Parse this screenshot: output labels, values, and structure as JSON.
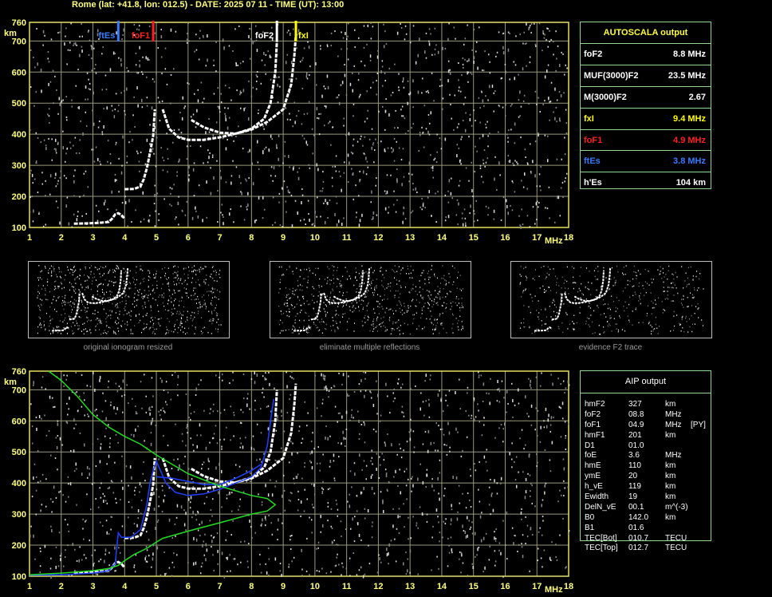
{
  "header": "Rome (lat: +41.8, lon: 012.5) - DATE: 2025 07 11 - TIME (UT): 13:00",
  "colors": {
    "grid": "#9a9a7a",
    "frame": "#e6e060",
    "trace": "#ffffff",
    "fte": "#3a7aff",
    "fof1": "#ff2020",
    "fxi": "#ffff00",
    "green": "#22dd22",
    "blue": "#2040ff",
    "panel_border": "#8fd88f"
  },
  "autoscala": {
    "title": "AUTOSCALA output",
    "rows": [
      {
        "label": "foF2",
        "value": "8.8 MHz",
        "color": "#ffffff"
      },
      {
        "label": "MUF(3000)F2",
        "value": "23.5 MHz",
        "color": "#ffffff"
      },
      {
        "label": "M(3000)F2",
        "value": "2.67",
        "color": "#ffffff"
      },
      {
        "label": "fxI",
        "value": "9.4 MHz",
        "color": "#ffff00"
      },
      {
        "label": "foF1",
        "value": "4.9 MHz",
        "color": "#ff2020"
      },
      {
        "label": "ftEs",
        "value": "3.8 MHz",
        "color": "#3a7aff"
      },
      {
        "label": "h'Es",
        "value": "104    km",
        "color": "#ffffff"
      }
    ]
  },
  "aip": {
    "title": "AIP output",
    "rows": [
      {
        "label": "hmF2",
        "value": "327",
        "unit": "km",
        "note": ""
      },
      {
        "label": "foF2",
        "value": "08.8",
        "unit": "MHz",
        "note": ""
      },
      {
        "label": "foF1",
        "value": "04.9",
        "unit": "MHz",
        "note": "[PY]"
      },
      {
        "label": "hmF1",
        "value": "201",
        "unit": "km",
        "note": ""
      },
      {
        "label": "D1",
        "value": "01.0",
        "unit": "",
        "note": ""
      },
      {
        "label": "foE",
        "value": "3.6",
        "unit": "MHz",
        "note": ""
      },
      {
        "label": "hmE",
        "value": "110",
        "unit": "km",
        "note": ""
      },
      {
        "label": "ymE",
        "value": "20",
        "unit": "km",
        "note": ""
      },
      {
        "label": "h_vE",
        "value": "119",
        "unit": "km",
        "note": ""
      },
      {
        "label": "Ewidth",
        "value": "19",
        "unit": "km",
        "note": ""
      },
      {
        "label": "DelN_vE",
        "value": "00.1",
        "unit": "m^(-3)",
        "note": ""
      },
      {
        "label": "B0",
        "value": "142.0",
        "unit": "km",
        "note": ""
      },
      {
        "label": "B1",
        "value": "01.6",
        "unit": "",
        "note": ""
      },
      {
        "label": "TEC[Bot]",
        "value": "010.7",
        "unit": "TECU",
        "note": ""
      },
      {
        "label": "TEC[Top]",
        "value": "012.7",
        "unit": "TECU",
        "note": ""
      }
    ]
  },
  "thumbnails": [
    {
      "caption": "original ionogram resized"
    },
    {
      "caption": "eliminate multiple reflections"
    },
    {
      "caption": "evidence F2 trace"
    }
  ],
  "chart_data": [
    {
      "type": "scatter",
      "title": "",
      "xlabel": "MHz",
      "ylabel": "km",
      "xlim": [
        1,
        18
      ],
      "ylim": [
        100,
        760
      ],
      "x_ticks": [
        "1",
        "2",
        "3",
        "4",
        "5",
        "6",
        "7",
        "8",
        "9",
        "10",
        "11",
        "12",
        "13",
        "14",
        "15",
        "16",
        "17",
        "18"
      ],
      "y_ticks": [
        "100",
        "200",
        "300",
        "400",
        "500",
        "600",
        "700",
        "760"
      ],
      "grid": true,
      "markers": [
        {
          "name": "ftEs",
          "x": 3.8,
          "color": "#3a7aff"
        },
        {
          "name": "foF1",
          "x": 4.9,
          "color": "#ff2020"
        },
        {
          "name": "foF2",
          "x": 8.8,
          "color": "#ffffff"
        },
        {
          "name": "fxI",
          "x": 9.4,
          "color": "#ffff00"
        }
      ],
      "series": [
        {
          "color": "#ffffff",
          "points": [
            [
              2.4,
              112
            ],
            [
              2.8,
              113
            ],
            [
              3.2,
              115
            ],
            [
              3.5,
              118
            ],
            [
              3.6,
              128
            ],
            [
              3.7,
              142
            ],
            [
              3.8,
              146
            ],
            [
              3.9,
              140
            ],
            [
              4.0,
              128
            ]
          ]
        },
        {
          "color": "#ffffff",
          "points": [
            [
              4.0,
              223
            ],
            [
              4.3,
              224
            ],
            [
              4.5,
              232
            ],
            [
              4.6,
              255
            ],
            [
              4.7,
              290
            ],
            [
              4.8,
              340
            ],
            [
              4.9,
              395
            ],
            [
              4.95,
              480
            ]
          ]
        },
        {
          "color": "#ffffff",
          "points": [
            [
              5.2,
              480
            ],
            [
              5.4,
              418
            ],
            [
              5.7,
              390
            ],
            [
              6.0,
              382
            ],
            [
              6.5,
              382
            ],
            [
              7.0,
              390
            ],
            [
              7.5,
              402
            ],
            [
              8.0,
              418
            ],
            [
              8.4,
              450
            ],
            [
              8.6,
              500
            ],
            [
              8.75,
              600
            ],
            [
              8.8,
              700
            ]
          ]
        },
        {
          "color": "#ffffff",
          "points": [
            [
              6.1,
              446
            ],
            [
              6.5,
              422
            ],
            [
              7.0,
              405
            ],
            [
              7.5,
              402
            ],
            [
              8.0,
              415
            ],
            [
              8.5,
              440
            ],
            [
              9.0,
              480
            ],
            [
              9.25,
              560
            ],
            [
              9.35,
              650
            ],
            [
              9.4,
              720
            ]
          ]
        }
      ]
    },
    {
      "type": "line",
      "title": "",
      "xlabel": "MHz",
      "ylabel": "km",
      "xlim": [
        1,
        18
      ],
      "ylim": [
        100,
        760
      ],
      "x_ticks": [
        "1",
        "2",
        "3",
        "4",
        "5",
        "6",
        "7",
        "8",
        "9",
        "10",
        "11",
        "12",
        "13",
        "14",
        "15",
        "16",
        "17",
        "18"
      ],
      "y_ticks": [
        "100",
        "200",
        "300",
        "400",
        "500",
        "600",
        "700",
        "760"
      ],
      "grid": true,
      "series": [
        {
          "color": "#ffffff",
          "points": [
            [
              2.4,
              112
            ],
            [
              2.8,
              113
            ],
            [
              3.2,
              115
            ],
            [
              3.5,
              118
            ],
            [
              3.6,
              128
            ],
            [
              3.7,
              142
            ],
            [
              3.8,
              146
            ],
            [
              3.9,
              140
            ],
            [
              4.0,
              128
            ]
          ]
        },
        {
          "color": "#ffffff",
          "points": [
            [
              4.0,
              223
            ],
            [
              4.3,
              224
            ],
            [
              4.5,
              232
            ],
            [
              4.6,
              255
            ],
            [
              4.7,
              290
            ],
            [
              4.8,
              340
            ],
            [
              4.9,
              395
            ],
            [
              4.95,
              480
            ]
          ]
        },
        {
          "color": "#ffffff",
          "points": [
            [
              5.2,
              480
            ],
            [
              5.4,
              418
            ],
            [
              5.7,
              390
            ],
            [
              6.0,
              382
            ],
            [
              6.5,
              382
            ],
            [
              7.0,
              390
            ],
            [
              7.5,
              402
            ],
            [
              8.0,
              418
            ],
            [
              8.4,
              450
            ],
            [
              8.6,
              500
            ],
            [
              8.75,
              600
            ],
            [
              8.8,
              700
            ]
          ]
        },
        {
          "color": "#ffffff",
          "points": [
            [
              6.1,
              446
            ],
            [
              6.5,
              422
            ],
            [
              7.0,
              405
            ],
            [
              7.5,
              402
            ],
            [
              8.0,
              415
            ],
            [
              8.5,
              440
            ],
            [
              9.0,
              480
            ],
            [
              9.25,
              560
            ],
            [
              9.35,
              650
            ],
            [
              9.4,
              720
            ]
          ]
        },
        {
          "color": "#2040ff",
          "points": [
            [
              1.0,
              103
            ],
            [
              2.0,
              105
            ],
            [
              3.0,
              110
            ],
            [
              3.5,
              118
            ],
            [
              3.7,
              140
            ],
            [
              3.8,
              240
            ],
            [
              3.9,
              225
            ],
            [
              4.2,
              225
            ],
            [
              4.5,
              250
            ],
            [
              4.7,
              330
            ],
            [
              4.8,
              400
            ],
            [
              4.9,
              440
            ],
            [
              5.0,
              470
            ],
            [
              5.3,
              400
            ],
            [
              5.6,
              370
            ],
            [
              6.0,
              360
            ],
            [
              6.5,
              365
            ],
            [
              7.0,
              380
            ],
            [
              7.5,
              400
            ],
            [
              8.0,
              420
            ],
            [
              8.3,
              450
            ],
            [
              8.5,
              520
            ],
            [
              8.6,
              600
            ],
            [
              8.7,
              670
            ]
          ]
        },
        {
          "color": "#2040ff",
          "points": [
            [
              5.0,
              420
            ],
            [
              5.5,
              415
            ],
            [
              6.0,
              405
            ],
            [
              6.5,
              395
            ],
            [
              7.0,
              395
            ],
            [
              7.5,
              415
            ],
            [
              8.0,
              440
            ],
            [
              8.3,
              460
            ]
          ]
        },
        {
          "color": "#22dd22",
          "points": [
            [
              1.6,
              760
            ],
            [
              2.0,
              730
            ],
            [
              2.5,
              680
            ],
            [
              3.0,
              620
            ],
            [
              3.5,
              580
            ],
            [
              4.0,
              550
            ],
            [
              4.5,
              525
            ],
            [
              5.0,
              490
            ],
            [
              6.0,
              430
            ],
            [
              7.0,
              390
            ],
            [
              8.0,
              360
            ],
            [
              8.5,
              350
            ],
            [
              8.75,
              330
            ],
            [
              8.5,
              310
            ],
            [
              8.0,
              300
            ],
            [
              7.0,
              272
            ],
            [
              6.0,
              245
            ],
            [
              5.2,
              222
            ],
            [
              5.0,
              210
            ],
            [
              4.7,
              190
            ],
            [
              4.3,
              170
            ],
            [
              4.0,
              150
            ],
            [
              3.8,
              135
            ],
            [
              3.5,
              125
            ],
            [
              3.0,
              118
            ],
            [
              2.0,
              110
            ],
            [
              1.0,
              105
            ]
          ]
        }
      ]
    }
  ]
}
